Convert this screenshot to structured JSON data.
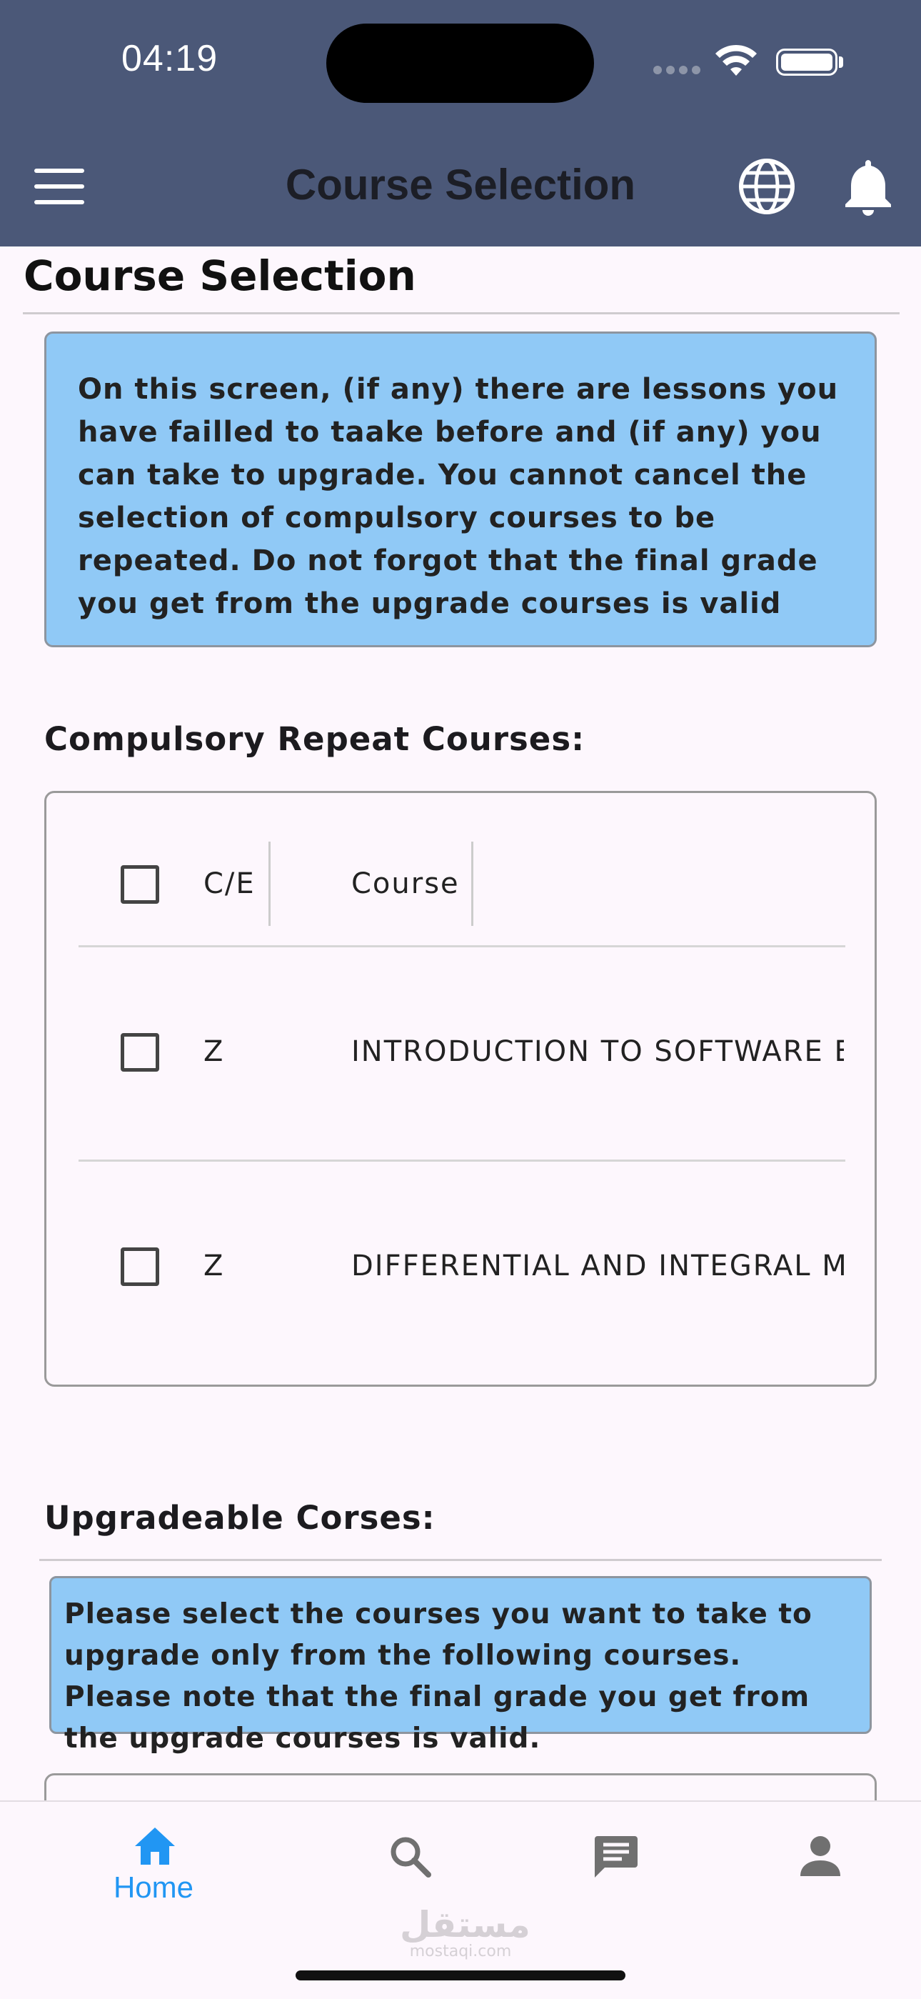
{
  "status_bar": {
    "time": "04:19"
  },
  "app_bar": {
    "title": "Course Selection",
    "menu_icon": "menu-icon",
    "language_icon": "globe-icon",
    "notification_icon": "bell-icon"
  },
  "page": {
    "heading": "Course Selection",
    "info_text": "On this screen, (if any) there are lessons you have failled to taake before and (if any) you can take to upgrade. You cannot cancel the selection of compulsory courses to be repeated. Do not forgot that the final grade you get from the upgrade courses is valid"
  },
  "compulsory": {
    "title": "Compulsory Repeat Courses:",
    "columns": {
      "ce": "C/E",
      "course": "Course"
    },
    "rows": [
      {
        "ce": "Z",
        "course": "INTRODUCTION TO SOFTWARE ENGINEERING"
      },
      {
        "ce": "Z",
        "course": "DIFFERENTIAL AND INTEGRAL MATHEMATICS"
      }
    ]
  },
  "upgradeable": {
    "title": "Upgradeable Corses:",
    "info_text": "Please select the courses you want to take to upgrade only from the following courses. Please note that the final grade you get from the upgrade courses is valid."
  },
  "bottom_nav": {
    "items": [
      {
        "label": "Home",
        "icon": "home-icon",
        "active": true
      },
      {
        "label": "",
        "icon": "search-icon",
        "active": false
      },
      {
        "label": "",
        "icon": "chat-icon",
        "active": false
      },
      {
        "label": "",
        "icon": "person-icon",
        "active": false
      }
    ]
  },
  "watermark": {
    "arabic": "مستقل",
    "latin": "mostaqi.com"
  },
  "colors": {
    "app_bar": "#4b5878",
    "info_box": "#90c9f6",
    "accent": "#2196f3",
    "background": "#fdf7fd"
  }
}
